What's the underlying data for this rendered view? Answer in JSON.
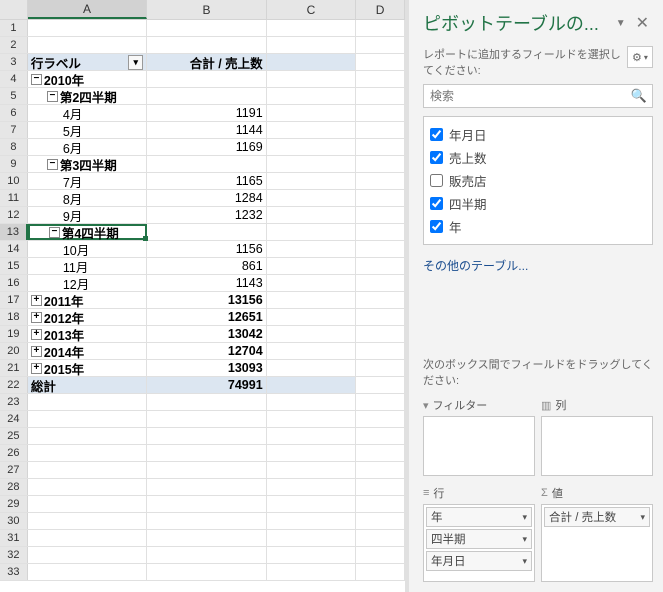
{
  "columns": [
    "A",
    "B",
    "C",
    "D"
  ],
  "pivot": {
    "header_rowlabel": "行ラベル",
    "header_value": "合計 / 売上数",
    "rows": [
      {
        "type": "year",
        "label": "2010年",
        "expand": "−"
      },
      {
        "type": "quarter",
        "label": "第2四半期",
        "expand": "−"
      },
      {
        "type": "month",
        "label": "4月",
        "value": 1191
      },
      {
        "type": "month",
        "label": "5月",
        "value": 1144
      },
      {
        "type": "month",
        "label": "6月",
        "value": 1169
      },
      {
        "type": "quarter",
        "label": "第3四半期",
        "expand": "−"
      },
      {
        "type": "month",
        "label": "7月",
        "value": 1165
      },
      {
        "type": "month",
        "label": "8月",
        "value": 1284
      },
      {
        "type": "month",
        "label": "9月",
        "value": 1232
      },
      {
        "type": "quarter",
        "label": "第4四半期",
        "expand": "−",
        "active": true
      },
      {
        "type": "month",
        "label": "10月",
        "value": 1156
      },
      {
        "type": "month",
        "label": "11月",
        "value": 861
      },
      {
        "type": "month",
        "label": "12月",
        "value": 1143
      },
      {
        "type": "year",
        "label": "2011年",
        "expand": "+",
        "value": 13156
      },
      {
        "type": "year",
        "label": "2012年",
        "expand": "+",
        "value": 12651
      },
      {
        "type": "year",
        "label": "2013年",
        "expand": "+",
        "value": 13042
      },
      {
        "type": "year",
        "label": "2014年",
        "expand": "+",
        "value": 12704
      },
      {
        "type": "year",
        "label": "2015年",
        "expand": "+",
        "value": 13093
      }
    ],
    "grand_label": "総計",
    "grand_value": 74991
  },
  "pane": {
    "title": "ピボットテーブルの...",
    "subtitle": "レポートに追加するフィールドを選択してください:",
    "search_placeholder": "検索",
    "fields": [
      {
        "label": "年月日",
        "checked": true
      },
      {
        "label": "売上数",
        "checked": true
      },
      {
        "label": "販売店",
        "checked": false
      },
      {
        "label": "四半期",
        "checked": true
      },
      {
        "label": "年",
        "checked": true
      }
    ],
    "other_tables": "その他のテーブル...",
    "areas_desc": "次のボックス間でフィールドをドラッグしてください:",
    "area_labels": {
      "filter": "フィルター",
      "cols": "列",
      "rows": "行",
      "vals": "値"
    },
    "row_pills": [
      "年",
      "四半期",
      "年月日"
    ],
    "val_pills": [
      "合計 / 売上数"
    ]
  }
}
